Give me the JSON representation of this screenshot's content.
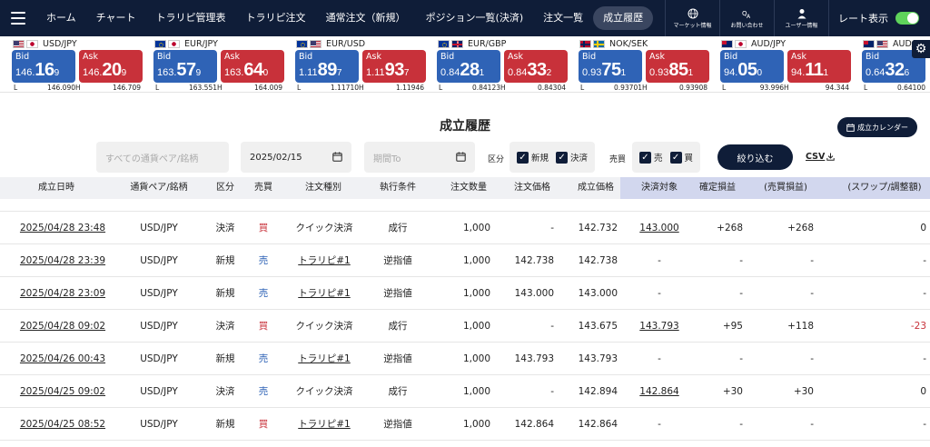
{
  "nav": {
    "items": [
      "ホーム",
      "チャート",
      "トラリピ管理表",
      "トラリピ注文",
      "通常注文（新規）",
      "ポジション一覧(決済)",
      "注文一覧",
      "成立履歴"
    ],
    "active_index": 7,
    "market_label": "マーケット情報",
    "contact_label": "お問い合わせ",
    "user_label": "ユーザー情報",
    "rate_toggle_label": "レート表示",
    "rate_toggle_on": true
  },
  "rates": [
    {
      "pair": "USD/JPY",
      "flags": [
        "usd",
        "jpy"
      ],
      "bid_label": "Bid",
      "ask_label": "Ask",
      "bid": [
        "146.",
        "16",
        "9"
      ],
      "ask": [
        "146.",
        "20",
        "9"
      ],
      "low_label": "L",
      "high_label": "H",
      "low": "146.090",
      "high": "146.709"
    },
    {
      "pair": "EUR/JPY",
      "flags": [
        "eur",
        "jpy"
      ],
      "bid_label": "Bid",
      "ask_label": "Ask",
      "bid": [
        "163.",
        "57",
        "9"
      ],
      "ask": [
        "163.",
        "64",
        "0"
      ],
      "low_label": "L",
      "high_label": "H",
      "low": "163.551",
      "high": "164.009"
    },
    {
      "pair": "EUR/USD",
      "flags": [
        "eur",
        "usd"
      ],
      "bid_label": "Bid",
      "ask_label": "Ask",
      "bid": [
        "1.11",
        "89",
        "7"
      ],
      "ask": [
        "1.11",
        "93",
        "7"
      ],
      "low_label": "L",
      "high_label": "H",
      "low": "1.11710",
      "high": "1.11946"
    },
    {
      "pair": "EUR/GBP",
      "flags": [
        "eur",
        "gbp"
      ],
      "bid_label": "Bid",
      "ask_label": "Ask",
      "bid": [
        "0.84",
        "28",
        "1"
      ],
      "ask": [
        "0.84",
        "33",
        "2"
      ],
      "low_label": "L",
      "high_label": "H",
      "low": "0.84123",
      "high": "0.84304"
    },
    {
      "pair": "NOK/SEK",
      "flags": [
        "nok",
        "sek"
      ],
      "bid_label": "Bid",
      "ask_label": "Ask",
      "bid": [
        "0.93",
        "75",
        "1"
      ],
      "ask": [
        "0.93",
        "85",
        "1"
      ],
      "low_label": "L",
      "high_label": "H",
      "low": "0.93701",
      "high": "0.93908"
    },
    {
      "pair": "AUD/JPY",
      "flags": [
        "aud",
        "jpy"
      ],
      "bid_label": "Bid",
      "ask_label": "Ask",
      "bid": [
        "94.",
        "05",
        "0"
      ],
      "ask": [
        "94.",
        "11",
        "1"
      ],
      "low_label": "L",
      "high_label": "H",
      "low": "93.996",
      "high": "94.344"
    },
    {
      "pair": "AUD/U",
      "flags": [
        "aud",
        "usd"
      ],
      "bid_label": "Bid",
      "ask_label": "",
      "bid": [
        "0.64",
        "32",
        "6"
      ],
      "ask": [
        "",
        "",
        ""
      ],
      "low_label": "L",
      "high_label": "",
      "low": "0.64100",
      "high": ""
    }
  ],
  "settings_icon": "gear-icon",
  "page": {
    "title": "成立履歴",
    "calendar_button": "成立カレンダー"
  },
  "filters": {
    "pair_placeholder": "すべての通貨ペア/銘柄",
    "date_from": "2025/02/15",
    "date_to_placeholder": "期間To",
    "kubun_label": "区分",
    "kubun_options": [
      {
        "label": "新規",
        "checked": true
      },
      {
        "label": "決済",
        "checked": true
      }
    ],
    "baibai_label": "売買",
    "baibai_options": [
      {
        "label": "売",
        "checked": true
      },
      {
        "label": "買",
        "checked": true
      }
    ],
    "narrow_button": "絞り込む",
    "csv_label": "CSV"
  },
  "table": {
    "headers": [
      "成立日時",
      "通貨ペア/銘柄",
      "区分",
      "売買",
      "注文種別",
      "執行条件",
      "注文数量",
      "注文価格",
      "成立価格",
      "決済対象",
      "確定損益",
      "(売買損益)",
      "(スワップ/調整額)"
    ],
    "rows": [
      {
        "datetime": "2025/04/28 23:48",
        "pair": "USD/JPY",
        "kubun": "決済",
        "side": "買",
        "side_type": "buy",
        "order_type": "クイック決済",
        "order_link": false,
        "condition": "成行",
        "qty": "1,000",
        "order_price": "-",
        "fill_price": "142.732",
        "target": "143.000",
        "pnl": "+268",
        "trade_pnl": "+268",
        "swap": "0",
        "swap_neg": false
      },
      {
        "datetime": "2025/04/28 23:39",
        "pair": "USD/JPY",
        "kubun": "新規",
        "side": "売",
        "side_type": "sell",
        "order_type": "トラリピ#1",
        "order_link": true,
        "condition": "逆指値",
        "qty": "1,000",
        "order_price": "142.738",
        "fill_price": "142.738",
        "target": "-",
        "pnl": "-",
        "trade_pnl": "-",
        "swap": "-",
        "swap_neg": false
      },
      {
        "datetime": "2025/04/28 23:09",
        "pair": "USD/JPY",
        "kubun": "新規",
        "side": "売",
        "side_type": "sell",
        "order_type": "トラリピ#1",
        "order_link": true,
        "condition": "逆指値",
        "qty": "1,000",
        "order_price": "143.000",
        "fill_price": "143.000",
        "target": "-",
        "pnl": "-",
        "trade_pnl": "-",
        "swap": "-",
        "swap_neg": false
      },
      {
        "datetime": "2025/04/28 09:02",
        "pair": "USD/JPY",
        "kubun": "決済",
        "side": "買",
        "side_type": "buy",
        "order_type": "クイック決済",
        "order_link": false,
        "condition": "成行",
        "qty": "1,000",
        "order_price": "-",
        "fill_price": "143.675",
        "target": "143.793",
        "pnl": "+95",
        "trade_pnl": "+118",
        "swap": "-23",
        "swap_neg": true
      },
      {
        "datetime": "2025/04/26 00:43",
        "pair": "USD/JPY",
        "kubun": "新規",
        "side": "売",
        "side_type": "sell",
        "order_type": "トラリピ#1",
        "order_link": true,
        "condition": "逆指値",
        "qty": "1,000",
        "order_price": "143.793",
        "fill_price": "143.793",
        "target": "-",
        "pnl": "-",
        "trade_pnl": "-",
        "swap": "-",
        "swap_neg": false
      },
      {
        "datetime": "2025/04/25 09:02",
        "pair": "USD/JPY",
        "kubun": "決済",
        "side": "売",
        "side_type": "sell",
        "order_type": "クイック決済",
        "order_link": false,
        "condition": "成行",
        "qty": "1,000",
        "order_price": "-",
        "fill_price": "142.894",
        "target": "142.864",
        "pnl": "+30",
        "trade_pnl": "+30",
        "swap": "0",
        "swap_neg": false
      },
      {
        "datetime": "2025/04/25 08:52",
        "pair": "USD/JPY",
        "kubun": "新規",
        "side": "買",
        "side_type": "buy",
        "order_type": "トラリピ#1",
        "order_link": true,
        "condition": "逆指値",
        "qty": "1,000",
        "order_price": "142.864",
        "fill_price": "142.864",
        "target": "-",
        "pnl": "-",
        "trade_pnl": "-",
        "swap": "-",
        "swap_neg": false
      }
    ]
  }
}
